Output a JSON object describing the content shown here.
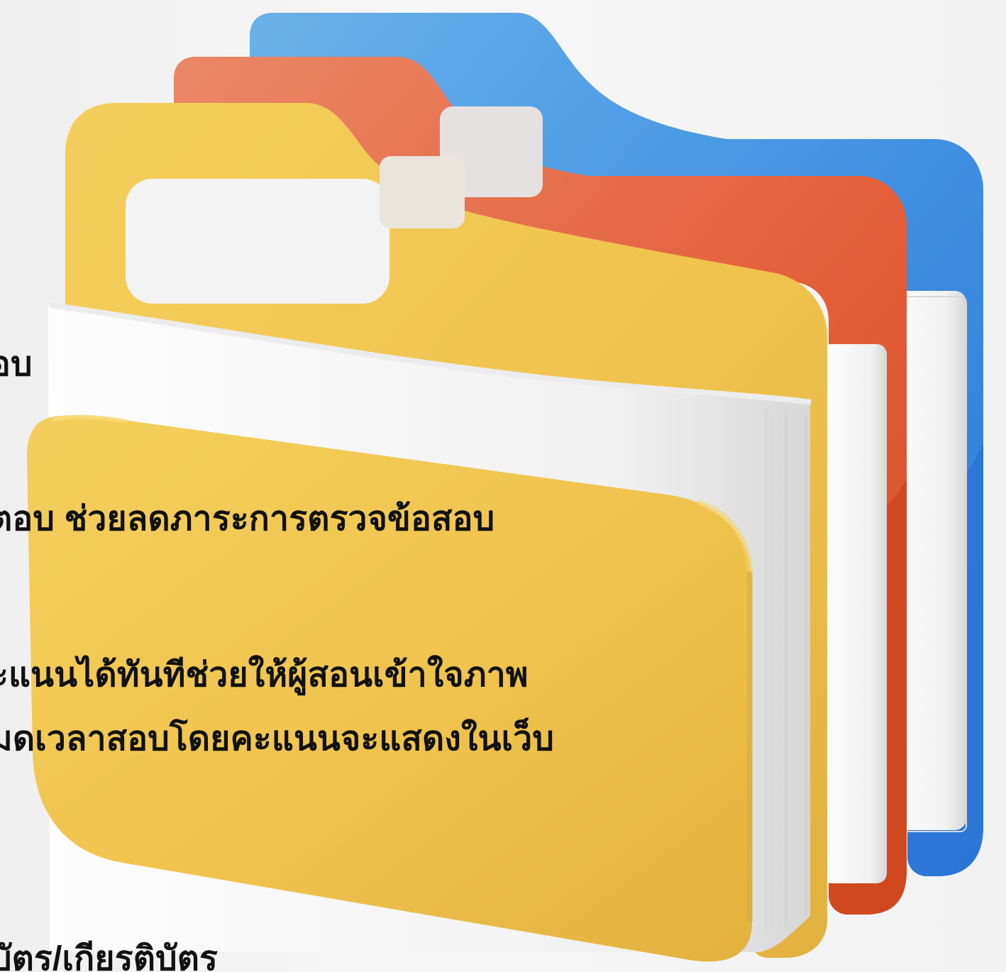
{
  "image": {
    "subject": "folder-stack-illustration"
  },
  "colors": {
    "background": "#f3f3f3",
    "blue_folder": "#4a90e2",
    "orange_folder": "#e35b32",
    "yellow_folder": "#f0c44c",
    "paper": "#f8f8f8",
    "text": "#111111"
  },
  "text": {
    "line1": "อบ",
    "line2": "ตอบ ช่วยลดภาระการตรวจข้อสอบ",
    "line3": "ะแนนได้ทันทีช่วยให้ผู้สอนเข้าใจภาพ",
    "line4": "มดเวลาสอบโดยคะแนนจะแสดงในเว็บ",
    "line5": "บัตร/เกียรติบัตร"
  }
}
